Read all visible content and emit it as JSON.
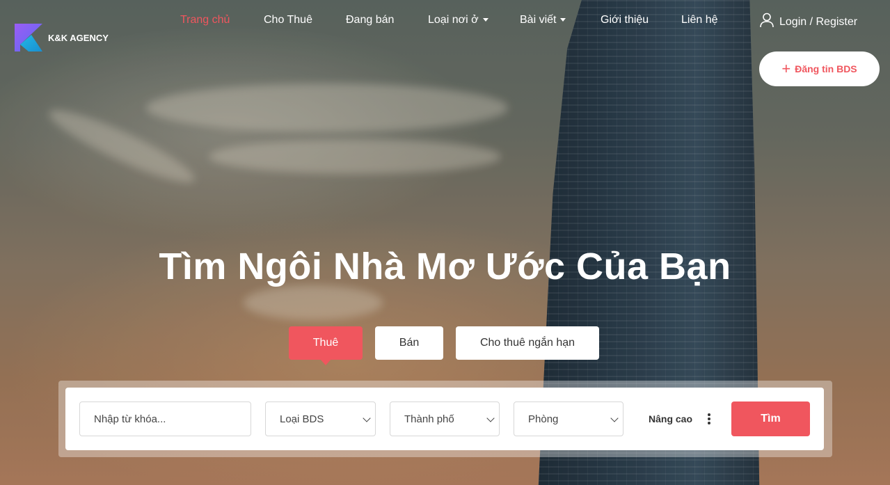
{
  "brand": {
    "name": "K&K AGENCY"
  },
  "colors": {
    "accent": "#f0565e",
    "white": "#ffffff"
  },
  "nav": {
    "items": [
      {
        "label": "Trang chủ",
        "active": true
      },
      {
        "label": "Cho Thuê"
      },
      {
        "label": "Đang bán"
      },
      {
        "label": "Loại nơi ở",
        "dropdown": true
      },
      {
        "label": "Bài viết",
        "dropdown": true
      },
      {
        "label": "Giới thiệu"
      },
      {
        "label": "Liên hệ"
      }
    ],
    "login_label": "Login / Register"
  },
  "post_button": {
    "label": "Đăng tin BDS",
    "icon": "plus-icon"
  },
  "hero": {
    "headline": "Tìm Ngôi Nhà Mơ Ước Của Bạn"
  },
  "tabs": [
    {
      "label": "Thuê",
      "active": true
    },
    {
      "label": "Bán"
    },
    {
      "label": "Cho thuê ngắn hạn"
    }
  ],
  "search": {
    "keyword_placeholder": "Nhập từ khóa...",
    "type_select": "Loại BDS",
    "city_select": "Thành phố",
    "room_select": "Phòng",
    "advanced_label": "Nâng cao",
    "submit_label": "Tìm"
  }
}
